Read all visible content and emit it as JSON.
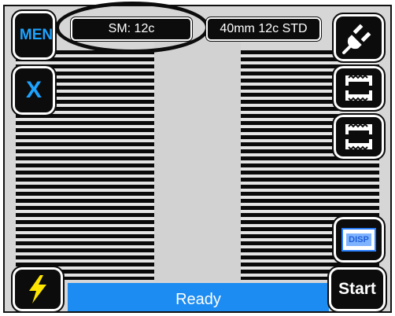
{
  "toolbar": {
    "menu_label": "MEN",
    "cancel_label": "X",
    "fiber_type": "SM: 12c",
    "splice_program": "40mm 12c STD",
    "display_label": "DISP",
    "start_label": "Start"
  },
  "status": {
    "text": "Ready"
  },
  "icons": {
    "plug": "plug-icon",
    "sleeve_heater_1": "heater-icon",
    "sleeve_heater_2": "heater-icon",
    "power": "lightning-bolt-icon"
  },
  "colors": {
    "accent": "#1da3ff",
    "status_bar": "#1c8cf2",
    "button_bg": "#0c0c0c"
  }
}
